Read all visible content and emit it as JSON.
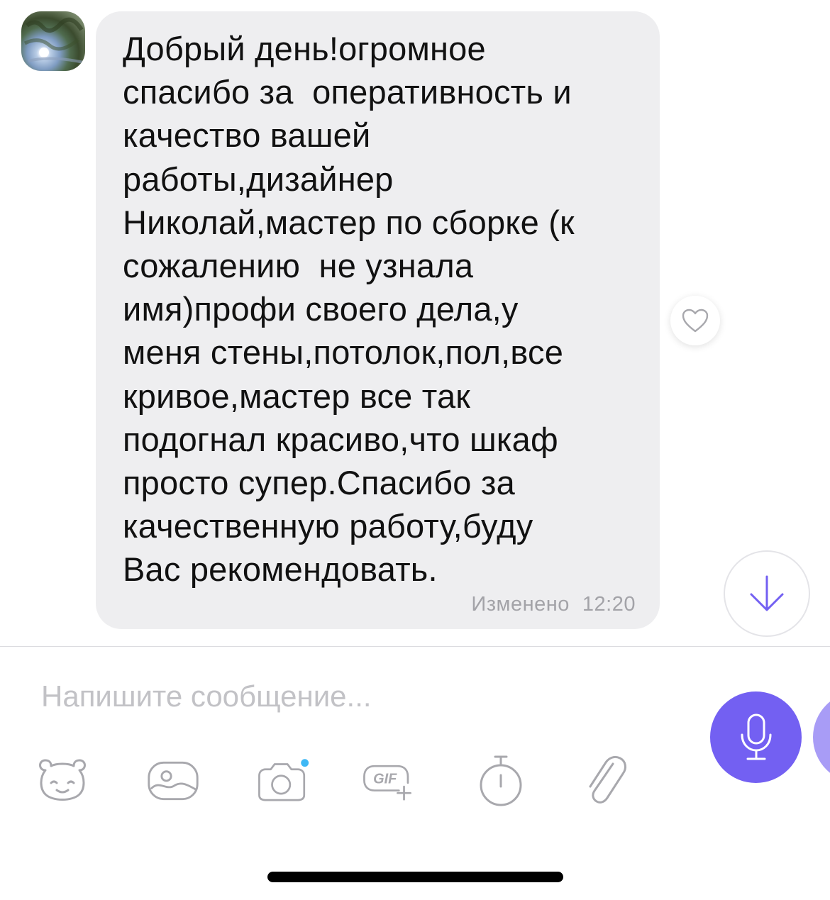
{
  "message": {
    "lines": [
      "Добрый день!огромное",
      "спасибо за  оперативность и",
      "качество вашей",
      "работы,дизайнер",
      "Николай,мастер по сборке (к",
      "сожалению  не узнала",
      "имя)профи своего дела,у",
      "меня стены,потолок,пол,все",
      "кривое,мастер все так",
      "подогнал красиво,что шкаф",
      "просто супер.Спасибо за",
      "качественную работу,буду",
      "Вас рекомендовать."
    ],
    "edited_label": "Изменено",
    "time": "12:20"
  },
  "composer": {
    "placeholder": "Напишите сообщение..."
  },
  "toolbar": {
    "icons": [
      "sticker-icon",
      "gallery-icon",
      "camera-icon",
      "gif-icon",
      "timer-icon",
      "attachment-icon"
    ],
    "gif_label": "GIF"
  },
  "colors": {
    "accent": "#7360f2",
    "bubble": "#eeeef0",
    "icon_gray": "#a8a8ad",
    "notification_dot": "#3fb8f5"
  }
}
